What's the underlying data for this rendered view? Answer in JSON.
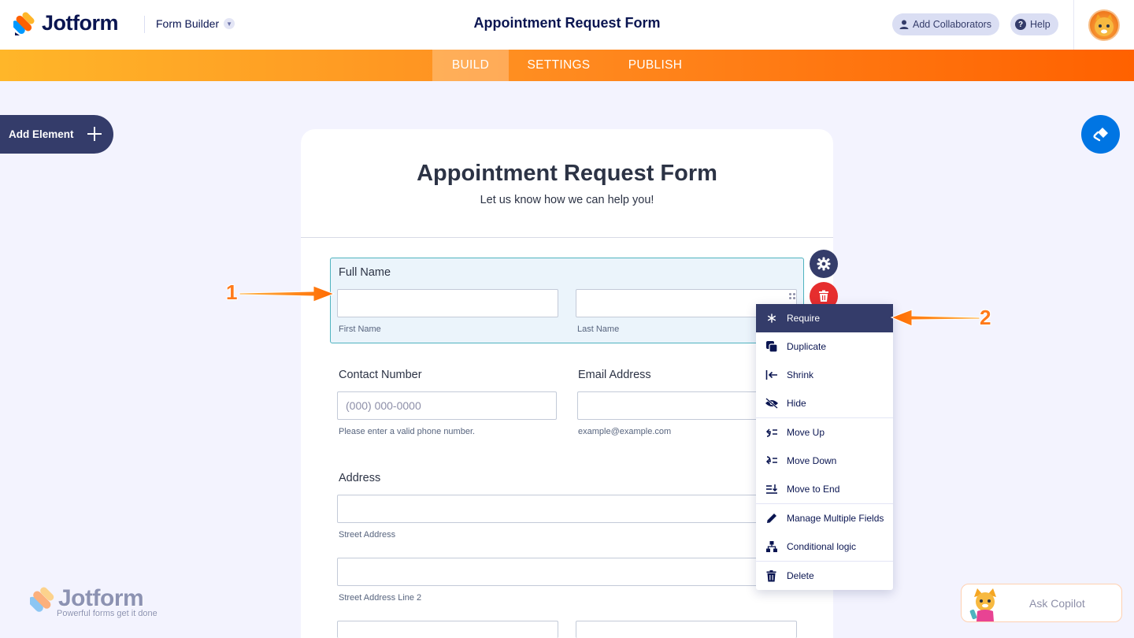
{
  "header": {
    "brand": "Jotform",
    "builder_dropdown": "Form Builder",
    "form_title": "Appointment Request Form",
    "add_collaborators": "Add Collaborators",
    "help": "Help"
  },
  "nav": {
    "tabs": [
      {
        "label": "BUILD",
        "active": true
      },
      {
        "label": "SETTINGS",
        "active": false
      },
      {
        "label": "PUBLISH",
        "active": false
      }
    ]
  },
  "sidebar": {
    "add_element": "Add Element"
  },
  "form": {
    "title": "Appointment Request Form",
    "subtitle": "Let us know how we can help you!",
    "fields": {
      "full_name": {
        "label": "Full Name",
        "first_sub": "First Name",
        "last_sub": "Last Name",
        "first_value": "",
        "last_value": ""
      },
      "contact": {
        "label": "Contact Number",
        "placeholder": "(000) 000-0000",
        "sub": "Please enter a valid phone number."
      },
      "email": {
        "label": "Email Address",
        "sub": "example@example.com"
      },
      "address": {
        "label": "Address",
        "street_sub": "Street Address",
        "street2_sub": "Street Address Line 2"
      }
    }
  },
  "context_menu": {
    "items": [
      {
        "label": "Require",
        "icon": "asterisk-icon",
        "active": true
      },
      {
        "label": "Duplicate",
        "icon": "duplicate-icon"
      },
      {
        "label": "Shrink",
        "icon": "shrink-icon"
      },
      {
        "label": "Hide",
        "icon": "eye-slash-icon"
      },
      {
        "label": "Move Up",
        "icon": "move-up-icon"
      },
      {
        "label": "Move Down",
        "icon": "move-down-icon"
      },
      {
        "label": "Move to End",
        "icon": "move-to-end-icon"
      },
      {
        "label": "Manage Multiple Fields",
        "icon": "pencil-icon"
      },
      {
        "label": "Conditional logic",
        "icon": "sitemap-icon"
      },
      {
        "label": "Delete",
        "icon": "trash-icon"
      }
    ]
  },
  "annotations": {
    "one": "1",
    "two": "2",
    "color": "#ff7a1a"
  },
  "watermark": {
    "brand": "Jotform",
    "tagline": "Powerful forms get it done"
  },
  "copilot": {
    "label": "Ask Copilot"
  },
  "colors": {
    "navy": "#343c6a",
    "orange": "#ff6100",
    "accent_blue": "#0075e3",
    "delete_red": "#e62e2e",
    "selected_border": "#4fb3bf"
  }
}
